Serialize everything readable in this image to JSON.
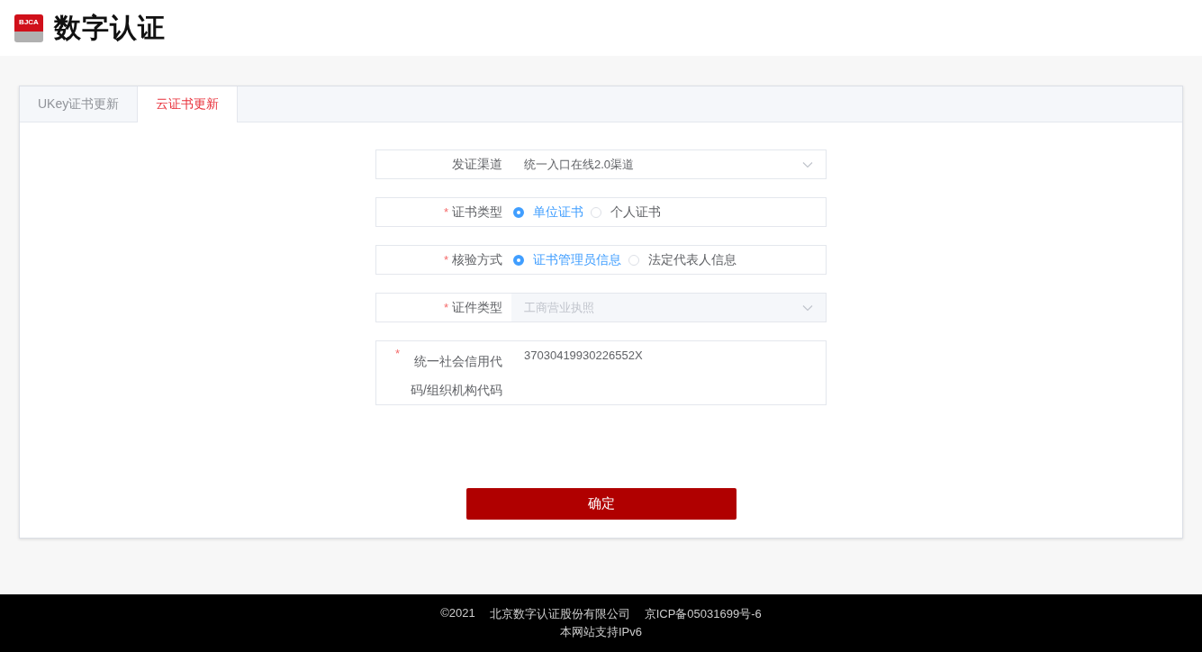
{
  "header": {
    "logo_badge": "BJCA",
    "logo_text": "数字认证"
  },
  "tabs": [
    {
      "label": "UKey证书更新",
      "selected": false
    },
    {
      "label": "云证书更新",
      "selected": true
    }
  ],
  "form": {
    "required_mark": "*",
    "fields": [
      {
        "kind": "select",
        "label": "发证渠道",
        "required": false,
        "value": "统一入口在线2.0渠道",
        "disabled": false
      },
      {
        "kind": "radio",
        "label": "证书类型",
        "required": true,
        "options": [
          {
            "label": "单位证书",
            "selected": true
          },
          {
            "label": "个人证书",
            "selected": false
          }
        ]
      },
      {
        "kind": "radio",
        "label": "核验方式",
        "required": true,
        "options": [
          {
            "label": "证书管理员信息",
            "selected": true
          },
          {
            "label": "法定代表人信息",
            "selected": false
          }
        ]
      },
      {
        "kind": "select",
        "label": "证件类型",
        "required": true,
        "value": "工商营业执照",
        "disabled": true
      },
      {
        "kind": "text",
        "label": "统一社会信用代码/组织机构代码",
        "required": true,
        "value": "37030419930226552X"
      }
    ],
    "submit": "确定"
  },
  "footer": {
    "line_1": [
      "©2021",
      "北京数字认证股份有限公司",
      "京ICP备05031699号-6"
    ],
    "line_2": "本网站支持IPv6"
  }
}
